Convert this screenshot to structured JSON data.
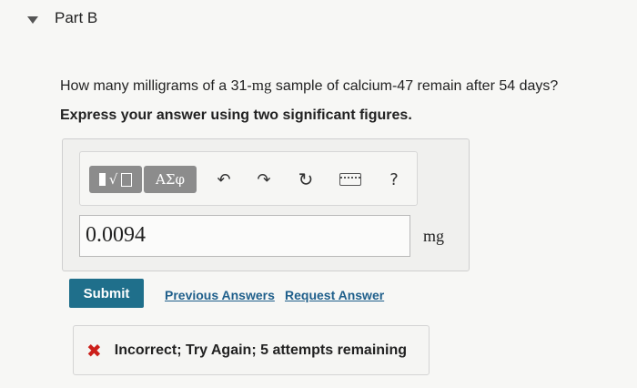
{
  "part": {
    "title": "Part B"
  },
  "question": {
    "text_before": "How many milligrams of a 31-",
    "unit_inline": "mg",
    "text_after": " sample of calcium-47 remain after 54 days?",
    "instruction": "Express your answer using two significant figures."
  },
  "toolbar": {
    "templates_icon": "templates-icon",
    "greek_label": "ΑΣφ",
    "undo_icon": "undo-icon",
    "redo_icon": "redo-icon",
    "reset_icon": "reset-icon",
    "keyboard_icon": "keyboard-icon",
    "help_label": "?"
  },
  "answer": {
    "value": "0.0094",
    "unit": "mg"
  },
  "actions": {
    "submit_label": "Submit",
    "previous_answers_label": "Previous Answers",
    "request_answer_label": "Request Answer"
  },
  "feedback": {
    "icon": "x-icon",
    "message": "Incorrect; Try Again; 5 attempts remaining"
  },
  "colors": {
    "submit": "#1f6f8b",
    "link": "#1f5f8b",
    "error": "#cc1f1a"
  }
}
